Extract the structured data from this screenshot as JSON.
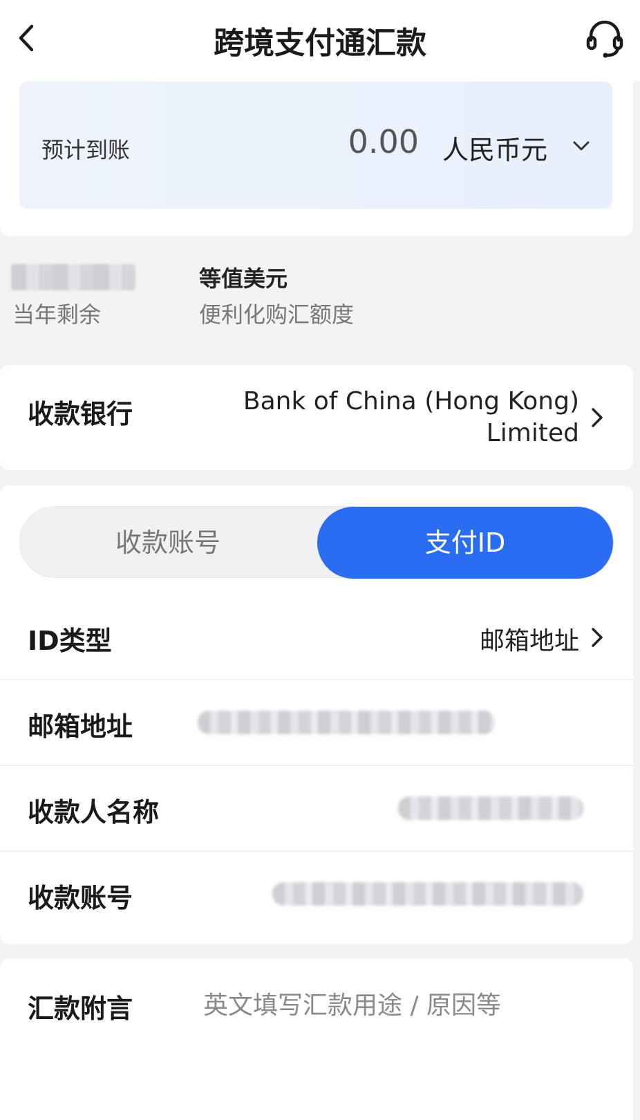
{
  "nav": {
    "title": "跨境支付通汇款",
    "back_icon": "chevron-left-icon",
    "support_icon": "headset-icon"
  },
  "estimate": {
    "label": "预计到账",
    "amount": "0.00",
    "currency": "人民币元",
    "dropdown_icon": "chevron-down-icon"
  },
  "quota": {
    "remaining_label": "当年剩余",
    "currency_label": "等值美元",
    "quota_label": "便利化购汇额度"
  },
  "bank": {
    "label": "收款银行",
    "value": "Bank of China (Hong Kong) Limited"
  },
  "segment": {
    "options": [
      "收款账号",
      "支付ID"
    ],
    "selected": "支付ID"
  },
  "form": {
    "id_type": {
      "label": "ID类型",
      "value": "邮箱地址"
    },
    "email": {
      "label": "邮箱地址"
    },
    "payee_name": {
      "label": "收款人名称"
    },
    "account": {
      "label": "收款账号"
    }
  },
  "note": {
    "label": "汇款附言",
    "placeholder": "英文填写汇款用途 / 原因等"
  },
  "colors": {
    "accent": "#2b6df0",
    "background": "#f3f3f5",
    "card": "#ffffff"
  }
}
